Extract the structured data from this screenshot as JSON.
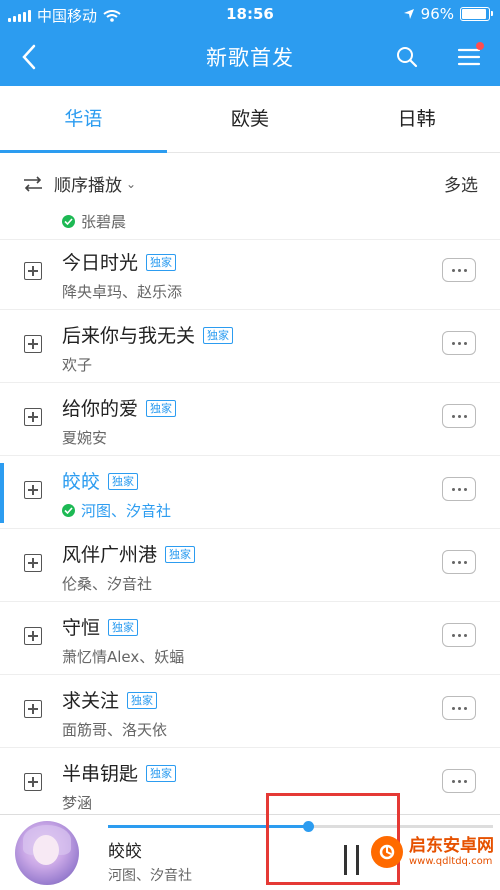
{
  "status": {
    "carrier": "中国移动",
    "time": "18:56",
    "battery": "96%"
  },
  "header": {
    "title": "新歌首发"
  },
  "tabs": [
    {
      "label": "华语"
    },
    {
      "label": "欧美"
    },
    {
      "label": "日韩"
    }
  ],
  "controls": {
    "order_label": "顺序播放",
    "multi_select": "多选"
  },
  "partial_row": {
    "artist": "张碧晨"
  },
  "songs": [
    {
      "title": "今日时光",
      "badge": "独家",
      "artist": "降央卓玛、赵乐添"
    },
    {
      "title": "后来你与我无关",
      "badge": "独家",
      "artist": "欢子"
    },
    {
      "title": "给你的爱",
      "badge": "独家",
      "artist": "夏婉安"
    },
    {
      "title": "皎皎",
      "badge": "独家",
      "artist": "河图、汐音社"
    },
    {
      "title": "风伴广州港",
      "badge": "独家",
      "artist": "伦桑、汐音社"
    },
    {
      "title": "守恒",
      "badge": "独家",
      "artist": "萧忆情Alex、妖蝠"
    },
    {
      "title": "求关注",
      "badge": "独家",
      "artist": "面筋哥、洛天依"
    },
    {
      "title": "半串钥匙",
      "badge": "独家",
      "artist": "梦涵"
    }
  ],
  "player": {
    "title": "皎皎",
    "artist": "河图、汐音社",
    "progress": 0.52
  },
  "watermark": {
    "title": "启东安卓网",
    "url": "www.qdltdq.com"
  },
  "colors": {
    "accent": "#2c9cf0",
    "highlight": "#e53935"
  }
}
